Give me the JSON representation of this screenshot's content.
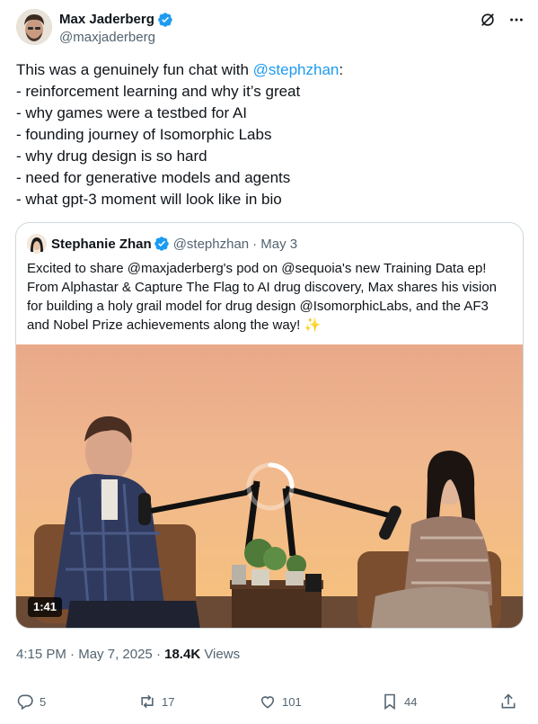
{
  "author": {
    "display_name": "Max Jaderberg",
    "handle": "@maxjaderberg",
    "verified": true
  },
  "tweet": {
    "intro": "This was a genuinely fun chat with ",
    "mention": "@stephzhan",
    "intro_end": ":",
    "bullets": [
      "- reinforcement learning and why it’s great",
      "- why games were a testbed for AI",
      "- founding journey of Isomorphic Labs",
      "- why drug design is so hard",
      "- need for generative models and agents",
      "- what gpt-3 moment will look like in bio"
    ]
  },
  "quote": {
    "display_name": "Stephanie Zhan",
    "handle": "@stephzhan",
    "date": "· May 3",
    "lines": [
      "Excited to share @maxjaderberg's pod on @sequoia's new Training Data ep!",
      "From Alphastar & Capture The Flag to AI drug discovery, Max shares his vision",
      "for building a holy grail model for drug design @IsomorphicLabs, and the AF3",
      "and Nobel Prize achievements along the way! ✨"
    ],
    "video_duration": "1:41"
  },
  "meta": {
    "time": "4:15 PM",
    "sep1": " · ",
    "date": "May 7, 2025",
    "sep2": " · ",
    "views_count": "18.4K",
    "views_label": " Views"
  },
  "actions": {
    "replies": "5",
    "reposts": "17",
    "likes": "101",
    "bookmarks": "44"
  },
  "colors": {
    "accent": "#1d9bf0",
    "text": "#0f1419",
    "secondary": "#536471",
    "border": "#cfd9de"
  },
  "icons": [
    "verified-badge-icon",
    "grok-icon",
    "more-icon",
    "reply-icon",
    "repost-icon",
    "like-icon",
    "bookmark-icon",
    "share-icon",
    "loading-spinner-icon"
  ]
}
